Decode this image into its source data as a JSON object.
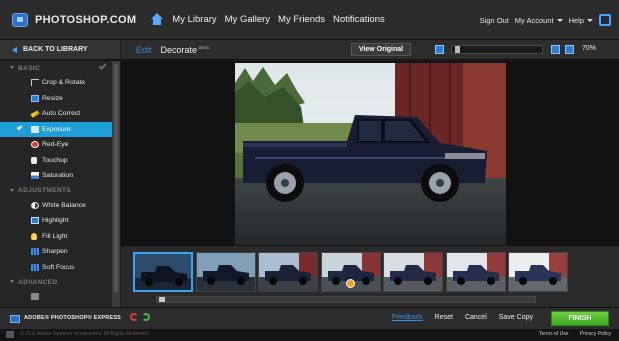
{
  "header": {
    "brand": "PHOTOSHOP.COM",
    "nav": [
      "My Library",
      "My Gallery",
      "My Friends",
      "Notifications"
    ],
    "sign_out": "Sign Out",
    "my_account": "My Account",
    "help": "Help"
  },
  "sidebar": {
    "back_label": "BACK TO LIBRARY",
    "sections": [
      {
        "title": "BASIC",
        "items": [
          {
            "label": "Crop & Rotate",
            "icon": "crop-icon"
          },
          {
            "label": "Resize",
            "icon": "resize-icon"
          },
          {
            "label": "Auto Correct",
            "icon": "auto-correct-icon"
          },
          {
            "label": "Exposure",
            "icon": "exposure-icon",
            "active": true
          },
          {
            "label": "Red-Eye",
            "icon": "red-eye-icon"
          },
          {
            "label": "Touchup",
            "icon": "touchup-icon"
          },
          {
            "label": "Saturation",
            "icon": "saturation-icon"
          }
        ]
      },
      {
        "title": "ADJUSTMENTS",
        "items": [
          {
            "label": "White Balance",
            "icon": "white-balance-icon"
          },
          {
            "label": "Highlight",
            "icon": "highlight-icon"
          },
          {
            "label": "Fill Light",
            "icon": "fill-light-icon"
          },
          {
            "label": "Sharpen",
            "icon": "sharpen-icon"
          },
          {
            "label": "Soft Focus",
            "icon": "soft-focus-icon"
          }
        ]
      },
      {
        "title": "ADVANCED",
        "items": []
      }
    ]
  },
  "editor": {
    "edit_label": "Edit",
    "decorate_label": "Decorate",
    "decorate_badge": "BETA",
    "view_original": "View Original",
    "zoom": "70%",
    "zoom_fraction": 0.03,
    "filmstrip_scroll_fraction": 0.0
  },
  "filmstrip": {
    "thumbnail_count": 7,
    "selected_index": 0,
    "badged_index": 3
  },
  "bottombar": {
    "product": "ADOBE® PHOTOSHOP® EXPRESS",
    "feedback": "Feedback",
    "reset": "Reset",
    "cancel": "Cancel",
    "save_copy": "Save Copy",
    "finish": "FINISH"
  },
  "footer": {
    "copyright": "© 2011 Adobe Systems Incorporated. All Rights Reserved.",
    "terms": "Terms of Use",
    "privacy": "Privacy Policy"
  },
  "colors": {
    "accent": "#1e9fd8",
    "finish_green": "#4fbf2a",
    "link_blue": "#2e8fe6"
  }
}
